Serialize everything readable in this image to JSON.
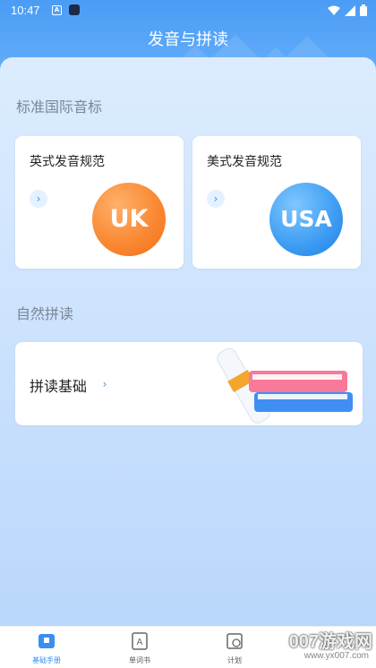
{
  "status_bar": {
    "time": "10:47"
  },
  "header": {
    "title": "发音与拼读"
  },
  "sections": {
    "phonetic": {
      "title": "标准国际音标",
      "cards": [
        {
          "label": "英式发音规范",
          "badge": "UK"
        },
        {
          "label": "美式发音规范",
          "badge": "USA"
        }
      ]
    },
    "phonics": {
      "title": "自然拼读",
      "card": {
        "label": "拼读基础"
      }
    }
  },
  "tabbar": {
    "tabs": [
      {
        "label": "基础手册",
        "active": true
      },
      {
        "label": "单词书",
        "active": false
      },
      {
        "label": "计划",
        "active": false
      }
    ]
  },
  "colors": {
    "accent": "#3a8ff0",
    "uk_badge": "#f9862f",
    "usa_badge": "#3c9cf3"
  },
  "watermark": {
    "text": "007游戏网",
    "sub": "www.yx007.com"
  }
}
